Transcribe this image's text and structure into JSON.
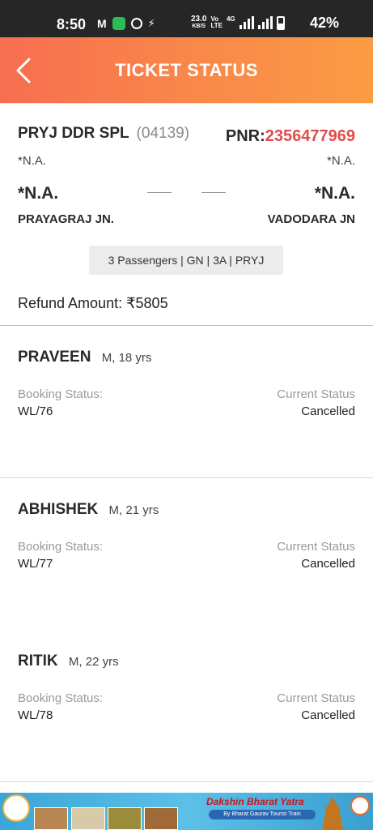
{
  "status_bar": {
    "time": "8:50",
    "mail_icon": "M",
    "speed_value": "23.0",
    "speed_unit": "KB/S",
    "network_top": "Vo",
    "network_bottom": "LTE",
    "net_type": "4G",
    "battery": "42%"
  },
  "header": {
    "title": "TICKET STATUS",
    "back_icon": "chevron-left-icon"
  },
  "train": {
    "name": "PRYJ DDR SPL",
    "number": "(04139)",
    "pnr_label": "PNR:",
    "pnr_value": "2356477969",
    "dep_time_small": "*N.A.",
    "arr_time_small": "*N.A.",
    "dep_time_big": "*N.A.",
    "arr_time_big": "*N.A.",
    "from_station": "PRAYAGRAJ JN.",
    "to_station": "VADODARA JN",
    "summary": "3 Passengers | GN | 3A | PRYJ"
  },
  "refund": {
    "text": "Refund Amount: ₹5805"
  },
  "passengers": [
    {
      "name": "PRAVEEN",
      "meta": "M, 18 yrs",
      "booking_label": "Booking Status:",
      "booking_value": "WL/76",
      "current_label": "Current Status",
      "current_value": "Cancelled"
    },
    {
      "name": "ABHISHEK",
      "meta": "M, 21 yrs",
      "booking_label": "Booking Status:",
      "booking_value": "WL/77",
      "current_label": "Current Status",
      "current_value": "Cancelled"
    },
    {
      "name": "RITIK",
      "meta": "M, 22 yrs",
      "booking_label": "Booking Status:",
      "booking_value": "WL/78",
      "current_label": "Current Status",
      "current_value": "Cancelled"
    }
  ],
  "banner": {
    "title": "Dakshin Bharat Yatra",
    "subtitle": "By Bharat Gaurav Tourist Train"
  },
  "colors": {
    "header_start": "#f76e50",
    "header_end": "#fb9c44",
    "pnr": "#e34c4c"
  }
}
